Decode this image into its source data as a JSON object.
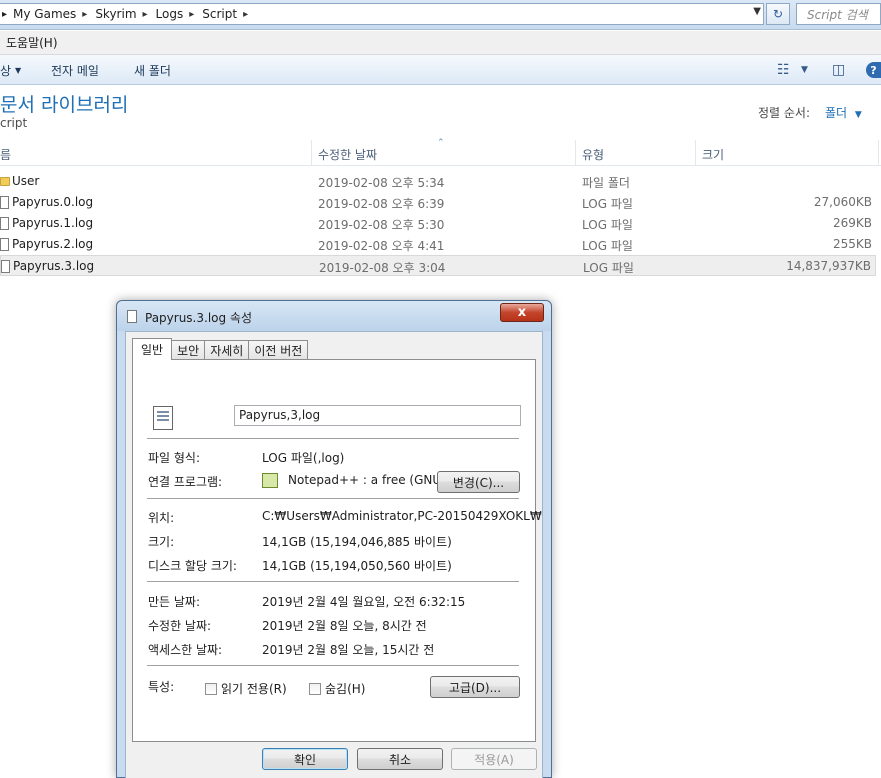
{
  "address": {
    "crumbs": [
      "My Games",
      "Skyrim",
      "Logs",
      "Script"
    ],
    "search_placeholder": "Script 검색"
  },
  "menu": {
    "help": "도움말(H)"
  },
  "toolbar": {
    "share_partial": "상",
    "email": "전자 메일",
    "new_folder": "새 폴더"
  },
  "library": {
    "title_partial": "문서 라이브러리",
    "subtitle_partial": "cript",
    "arrange_label": "정렬 순서:",
    "arrange_value": "폴더"
  },
  "columns": {
    "name_partial": "름",
    "modified": "수정한 날짜",
    "type": "유형",
    "size": "크기"
  },
  "files": [
    {
      "name": "User",
      "date": "2019-02-08 오후 5:34",
      "type": "파일 폴더",
      "size": "",
      "icon": "folder-icon"
    },
    {
      "name": "Papyrus.0.log",
      "date": "2019-02-08 오후 6:39",
      "type": "LOG 파일",
      "size": "27,060KB",
      "icon": "log-file-icon"
    },
    {
      "name": "Papyrus.1.log",
      "date": "2019-02-08 오후 5:30",
      "type": "LOG 파일",
      "size": "269KB",
      "icon": "log-file-icon"
    },
    {
      "name": "Papyrus.2.log",
      "date": "2019-02-08 오후 4:41",
      "type": "LOG 파일",
      "size": "255KB",
      "icon": "log-file-icon"
    },
    {
      "name": "Papyrus.3.log",
      "date": "2019-02-08 오후 3:04",
      "type": "LOG 파일",
      "size": "14,837,937KB",
      "icon": "log-file-icon",
      "selected": true
    }
  ],
  "dialog": {
    "title": "Papyrus.3.log 속성",
    "close": "x",
    "tabs": [
      "일반",
      "보안",
      "자세히",
      "이전 버전"
    ],
    "file_name": "Papyrus,3,log",
    "type_label": "파일 형식:",
    "type_value": "LOG 파일(,log)",
    "opens_label": "연결 프로그램:",
    "opens_value": "Notepad++ : a free (GNU)",
    "change_button": "변경(C)...",
    "location_label": "위치:",
    "location_value": "C:₩Users₩Administrator,PC-20150429XOKL₩",
    "size_label": "크기:",
    "size_value": "14,1GB (15,194,046,885 바이트)",
    "disk_label": "디스크 할당 크기:",
    "disk_value": "14,1GB (15,194,050,560 바이트)",
    "created_label": "만든 날짜:",
    "created_value": "2019년 2월 4일 월요일, 오전 6:32:15",
    "modified_label": "수정한 날짜:",
    "modified_value": "2019년 2월 8일 오늘, 8시간 전",
    "accessed_label": "액세스한 날짜:",
    "accessed_value": "2019년 2월 8일 오늘, 15시간 전",
    "attributes_label": "특성:",
    "readonly_label": "읽기 전용(R)",
    "hidden_label": "숨김(H)",
    "advanced_button": "고급(D)...",
    "ok_button": "확인",
    "cancel_button": "취소",
    "apply_button": "적용(A)"
  }
}
